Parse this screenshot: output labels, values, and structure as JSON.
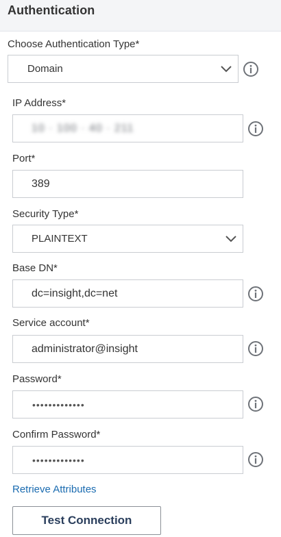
{
  "header": {
    "title": "Authentication"
  },
  "auth_type": {
    "label": "Choose Authentication Type*",
    "value": "Domain"
  },
  "ip_address": {
    "label": "IP Address*",
    "value": "10 · 100 · 40 · 211"
  },
  "port": {
    "label": "Port*",
    "value": "389"
  },
  "security_type": {
    "label": "Security Type*",
    "value": "PLAINTEXT"
  },
  "base_dn": {
    "label": "Base DN*",
    "value": "dc=insight,dc=net"
  },
  "service_account": {
    "label": "Service account*",
    "value": "administrator@insight"
  },
  "password": {
    "label": "Password*",
    "value": "•••••••••••••"
  },
  "confirm_password": {
    "label": "Confirm Password*",
    "value": "•••••••••••••"
  },
  "retrieve_link": {
    "label": "Retrieve Attributes"
  },
  "test_button": {
    "label": "Test Connection"
  },
  "colors": {
    "link": "#1a6bb0",
    "button_text": "#2a3e5c",
    "border": "#c9ccd1",
    "header_bg": "#f4f5f7"
  },
  "icons": {
    "info": "info-circle-icon",
    "dropdown": "chevron-down-icon"
  }
}
